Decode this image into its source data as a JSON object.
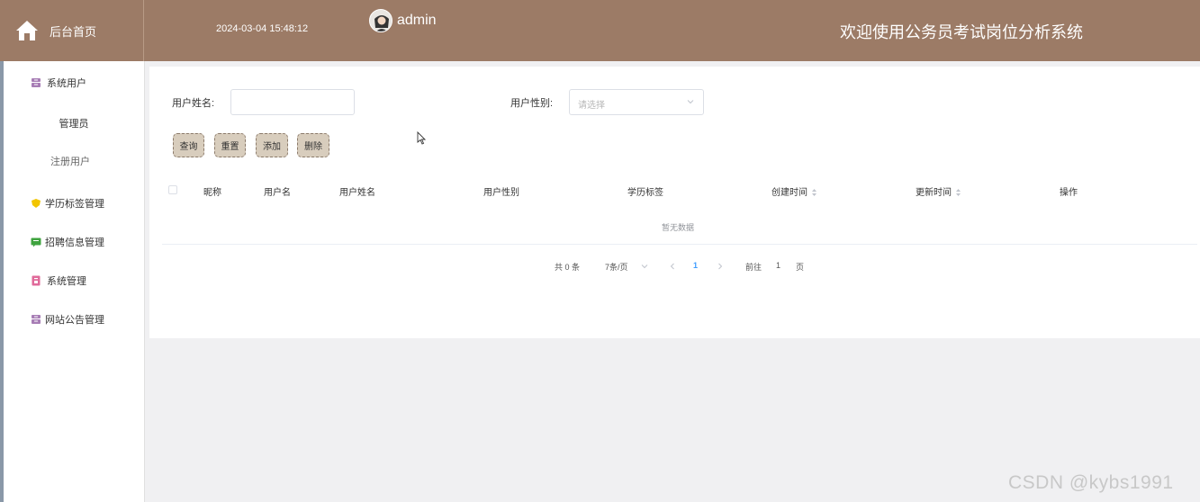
{
  "header": {
    "home_label": "后台首页",
    "datetime": "2024-03-04 15:48:12",
    "username": "admin",
    "site_title": "欢迎使用公务员考试岗位分析系统"
  },
  "sidebar": {
    "items": [
      {
        "label": "系统用户",
        "icon": "archive-icon",
        "color": "#a77db5"
      },
      {
        "label": "管理员"
      },
      {
        "label": "注册用户"
      },
      {
        "label": "学历标签管理",
        "icon": "shield-icon",
        "color": "#f2c500"
      },
      {
        "label": "招聘信息管理",
        "icon": "message-icon",
        "color": "#3fa33f"
      },
      {
        "label": "系统管理",
        "icon": "document-icon",
        "color": "#e06a9a"
      },
      {
        "label": "网站公告管理",
        "icon": "archive-icon",
        "color": "#a77db5"
      }
    ]
  },
  "search": {
    "name_label": "用户姓名:",
    "gender_label": "用户性别:",
    "gender_placeholder": "请选择"
  },
  "buttons": {
    "query": "查询",
    "reset": "重置",
    "add": "添加",
    "delete": "删除"
  },
  "table": {
    "columns": [
      "昵称",
      "用户名",
      "用户姓名",
      "用户性别",
      "学历标签",
      "创建时间",
      "更新时间",
      "操作"
    ],
    "empty_text": "暂无数据"
  },
  "pagination": {
    "total": "共 0 条",
    "page_size": "7条/页",
    "current_page": "1",
    "goto_label": "前往",
    "goto_value": "1",
    "page_unit": "页"
  },
  "watermark": "CSDN @kybs1991",
  "colors": {
    "header_bg": "#9c7b66",
    "button_bg": "#d8cdbd",
    "accent": "#409eff"
  }
}
